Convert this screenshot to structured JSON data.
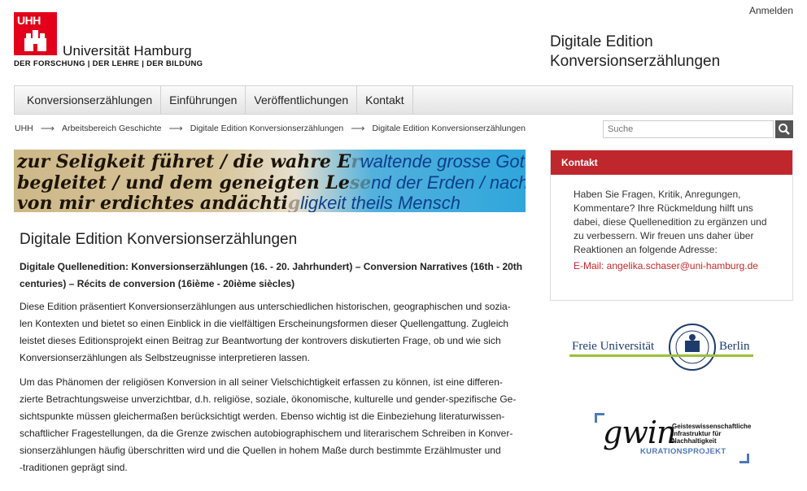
{
  "header": {
    "login": "Anmelden",
    "logo_abbr": "UHH",
    "logo_name": "Universität Hamburg",
    "logo_tagline": "DER FORSCHUNG | DER LEHRE | DER BILDUNG",
    "site_title_line1": "Digitale Edition",
    "site_title_line2": "Konversionserzählungen"
  },
  "nav": {
    "items": [
      {
        "label": "Konversionserzählungen"
      },
      {
        "label": "Einführungen"
      },
      {
        "label": "Veröffentlichungen"
      },
      {
        "label": "Kontakt"
      }
    ]
  },
  "breadcrumb": {
    "separator": "⟶",
    "items": [
      {
        "label": "UHH"
      },
      {
        "label": "Arbeitsbereich Geschichte"
      },
      {
        "label": "Digitale Edition Konversionserzählungen"
      },
      {
        "label": "Digitale Edition Konversionserzählungen"
      }
    ]
  },
  "search": {
    "placeholder": "Suche",
    "icon": "search-icon"
  },
  "banner": {
    "line1_old": "zur Seligkeit führet / die wahre E",
    "line1_mid": "r",
    "line1_new": "waltende grosse Gott",
    "line2_old": "begleitet / und dem geneigten Le",
    "line2_mid": "se",
    "line2_new": "nd der Erden / nach s",
    "line3_old": "von mir erdichtes andächti",
    "line3_mid": "g",
    "line3_new": "ligkeit theils Mensch"
  },
  "main": {
    "title": "Digitale Edition Konversionserzählungen",
    "subhead_line1": "Digitale Quellenedition: Konversionserzählungen (16. - 20. Jahrhundert) – Conversion Narratives (16th - 20th",
    "subhead_line2": "centuries) – Récits de conversion (16ième - 20ième siècles)",
    "para1_lines": [
      "Diese Edition präsentiert Konversionserzählungen aus unterschiedlichen historischen, geographischen und sozia-",
      "len Kontexten und bietet so einen Einblick in die vielfältigen Erscheinungsformen dieser Quellengattung.  Zugleich",
      "leistet dieses Editionsprojekt einen Beitrag zur Beantwortung der kontrovers diskutierten Frage, ob und wie sich",
      "Konversionserzählungen als Selbstzeugnisse interpretieren lassen."
    ],
    "para2_lines": [
      "Um das Phänomen der religiösen Konversion in all seiner Vielschichtigkeit  erfassen zu können, ist eine differen-",
      "zierte Betrachtungsweise unverzichtbar, d.h. religiöse, soziale, ökonomische, kulturelle und gender-spezifische Ge-",
      "sichtspunkte müssen gleichermaßen berücksichtigt werden. Ebenso wichtig ist die Einbeziehung literaturwissen-",
      "schaftlicher Fragestellungen, da die Grenze zwischen autobiographischem und literarischem Schreiben in Konver-",
      "sionserzählungen häufig überschritten wird und die Quellen in hohem Maße durch bestimmte Erzählmuster und",
      "-traditionen geprägt sind."
    ]
  },
  "contact": {
    "heading": "Kontakt",
    "body_lines": [
      "Haben Sie Fragen, Kritik, Anregungen,",
      "Kommentare? Ihre Rückmeldung hilft uns",
      "dabei, diese Quellenedition zu ergänzen und",
      "zu verbessern. Wir freuen uns daher über",
      "Reaktionen an folgende Adresse:"
    ],
    "email_prefix": "E-Mail: ",
    "email": "angelika.schaser@uni-hamburg.de"
  },
  "partners": {
    "fu_left": "Freie Universität",
    "fu_right": "Berlin",
    "gwin_word": "gwin",
    "gwin_line1": "Geisteswissenschaftliche",
    "gwin_line2": "Infrastruktur für",
    "gwin_line3": "Nachhaltigkeit",
    "gwin_kur": "KURATIONSPROJEKT"
  },
  "colors": {
    "accent_red": "#c0272d",
    "uhh_red": "#e2001a",
    "fu_green": "#9bbf3a",
    "gwin_blue": "#4f79b7"
  }
}
